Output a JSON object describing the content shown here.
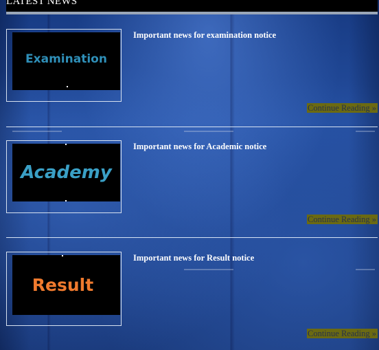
{
  "header": {
    "title": "LATEST NEWS"
  },
  "news": [
    {
      "thumb_label": "Examination",
      "thumb_color": "#2f8fb8",
      "title": "Important news for examination notice",
      "continue_label": "Continue Reading »"
    },
    {
      "thumb_label": "Academy",
      "thumb_color": "#3aa0c6",
      "title": "Important news for Academic notice",
      "continue_label": "Continue Reading »"
    },
    {
      "thumb_label": "Result",
      "thumb_color": "#f07a2e",
      "title": "Important news for Result notice",
      "continue_label": "Continue Reading »"
    }
  ]
}
